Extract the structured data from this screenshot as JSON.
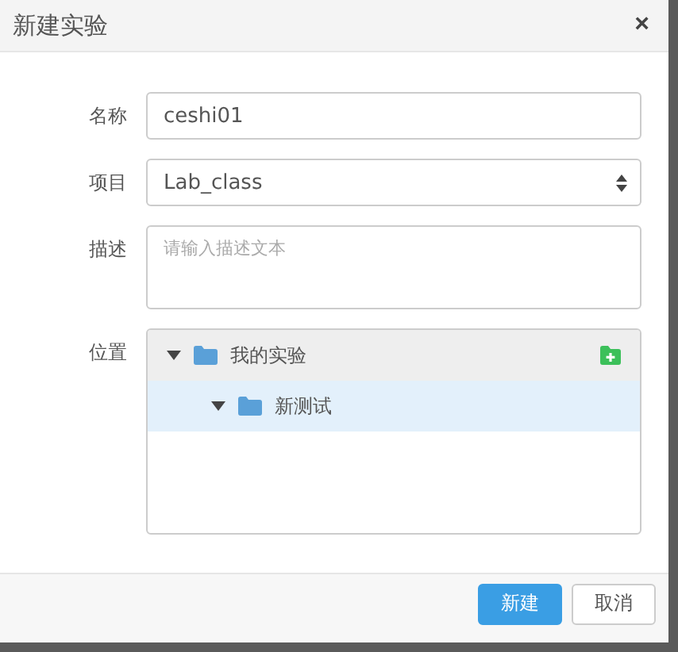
{
  "dialog": {
    "title": "新建实验",
    "close": "×"
  },
  "fields": [
    {
      "kind": "text",
      "label": "名称",
      "value": "ceshi01"
    },
    {
      "kind": "select",
      "label": "项目",
      "value": "Lab_class"
    },
    {
      "kind": "textarea",
      "label": "描述",
      "placeholder": "请输入描述文本"
    },
    {
      "kind": "tree",
      "label": "位置",
      "tree": [
        {
          "label": "我的实验",
          "expanded": true,
          "selected": false,
          "children": [
            {
              "label": "新测试",
              "expanded": true,
              "selected": true
            }
          ]
        }
      ]
    }
  ],
  "buttons": [
    {
      "label": "新建",
      "kind": "primary"
    },
    {
      "label": "取消",
      "kind": "default"
    }
  ]
}
